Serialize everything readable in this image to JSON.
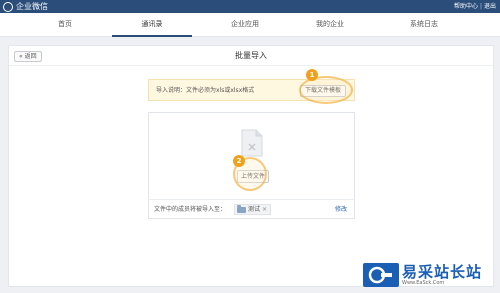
{
  "app": {
    "title": "企业微信"
  },
  "top_links": {
    "help": "帮助中心",
    "sep": "|",
    "logout": "退出"
  },
  "nav": {
    "items": [
      {
        "label": "首页",
        "active": false
      },
      {
        "label": "通讯录",
        "active": true
      },
      {
        "label": "企业应用",
        "active": false
      },
      {
        "label": "我的企业",
        "active": false
      },
      {
        "label": "系统日志",
        "active": false
      }
    ]
  },
  "page": {
    "back_label": "« 返回",
    "title": "批量导入"
  },
  "notice": {
    "text": "导入说明：文件必须为xls或xlsx格式",
    "download_label": "下载文件模板",
    "step": "1"
  },
  "upload": {
    "button_label": "上传文件",
    "step": "2"
  },
  "import_target": {
    "label": "文件中的成员将被导入至：",
    "department": "测试",
    "remove": "×",
    "modify": "修改"
  },
  "watermark": {
    "cn": "易采站长站",
    "url": "Www.EaSck.Com"
  },
  "colors": {
    "topbar": "#2a4d7a",
    "badge": "#f0a11b",
    "link": "#2a6ab8",
    "notice_bg": "#fff8e1"
  }
}
